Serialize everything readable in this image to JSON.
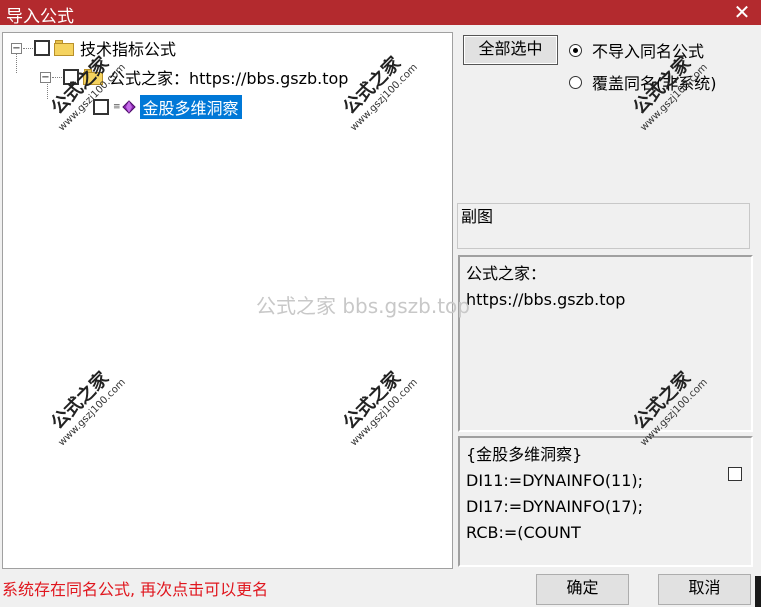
{
  "window": {
    "title": "导入公式",
    "close_glyph": "✕"
  },
  "tree": {
    "root_label": "技术指标公式",
    "child_label": "公式之家：https://bbs.gszb.top",
    "leaf_label": "金股多维洞察",
    "expander_glyph": "−",
    "formula_glyph": "≡"
  },
  "options": {
    "select_all_label": "全部选中",
    "radio_no_import": "不导入同名公式",
    "radio_overwrite": "覆盖同名(非系统)",
    "selected_radio": "no_import"
  },
  "panels": {
    "type_label": "副图",
    "description_line1": "公式之家：",
    "description_line2": "https://bbs.gszb.top",
    "code_lines": [
      "{金股多维洞察}",
      "DI11:=DYNAINFO(11);",
      "DI17:=DYNAINFO(17);",
      "RCB:=(COUNT"
    ]
  },
  "footer": {
    "status_text": "系统存在同名公式, 再次点击可以更名",
    "ok_label": "确定",
    "cancel_label": "取消"
  },
  "watermark": {
    "center_text": "公式之家 bbs.gszb.top",
    "stamp_title": "公式之家",
    "stamp_url": "www.gszj100.com"
  },
  "colors": {
    "titlebar": "#b32a2e",
    "selection": "#0078d7",
    "status_text": "#e0161e"
  }
}
